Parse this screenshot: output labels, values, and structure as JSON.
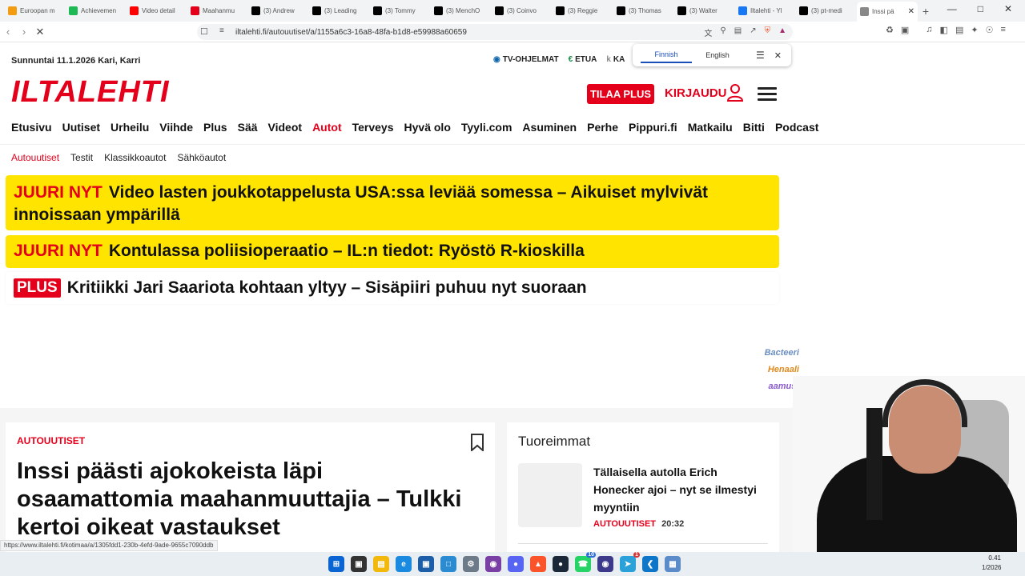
{
  "browser": {
    "tabs": [
      {
        "label": "Euroopan m",
        "icon": "alert-icon",
        "color": "#f39c12"
      },
      {
        "label": "Achievemen",
        "icon": "k-icon",
        "color": "#1db954"
      },
      {
        "label": "Video detail",
        "icon": "youtube-icon",
        "color": "#ff0000"
      },
      {
        "label": "Maahanmu",
        "icon": "il-icon",
        "color": "#e4001b"
      },
      {
        "label": "(3) Andrew",
        "icon": "x-icon",
        "color": "#000000"
      },
      {
        "label": "(3) Leading",
        "icon": "x-icon",
        "color": "#000000"
      },
      {
        "label": "(3) Tommy",
        "icon": "x-icon",
        "color": "#000000"
      },
      {
        "label": "(3) MenchO",
        "icon": "x-icon",
        "color": "#000000"
      },
      {
        "label": "(3) Coinvo",
        "icon": "x-icon",
        "color": "#000000"
      },
      {
        "label": "(3) Reggie",
        "icon": "x-icon",
        "color": "#000000"
      },
      {
        "label": "(3) Thomas",
        "icon": "x-icon",
        "color": "#000000"
      },
      {
        "label": "(3) Walter",
        "icon": "x-icon",
        "color": "#000000"
      },
      {
        "label": "Iltalehti - Yl",
        "icon": "facebook-icon",
        "color": "#1877f2"
      },
      {
        "label": "(3) pt-medi",
        "icon": "x-icon",
        "color": "#000000"
      },
      {
        "label": "Inssi pä",
        "icon": "loading-icon",
        "color": "#888888",
        "active": true
      }
    ],
    "url": "iltalehti.fi/autouutiset/a/1155a6c3-16a8-48fa-b1d8-e59988a60659",
    "status_url": "https://www.iltalehti.fi/kotimaa/a/1305fdd1-230b-4efd-9ade-9655c7090ddb",
    "translate": {
      "source": "Finnish",
      "target": "English"
    }
  },
  "site": {
    "date_line": "Sunnuntai 11.1.2026  Kari, Karri",
    "top_links": [
      "TV-OHJELMAT",
      "ETUA",
      "KA"
    ],
    "logo": "ILTALEHTI",
    "subscribe_label": "TILAA PLUS",
    "login_label": "KIRJAUDU",
    "main_nav": [
      {
        "label": "Etusivu"
      },
      {
        "label": "Uutiset"
      },
      {
        "label": "Urheilu"
      },
      {
        "label": "Viihde"
      },
      {
        "label": "Plus"
      },
      {
        "label": "Sää"
      },
      {
        "label": "Videot"
      },
      {
        "label": "Autot",
        "active": true
      },
      {
        "label": "Terveys"
      },
      {
        "label": "Hyvä olo"
      },
      {
        "label": "Tyyli.com"
      },
      {
        "label": "Asuminen"
      },
      {
        "label": "Perhe"
      },
      {
        "label": "Pippuri.fi"
      },
      {
        "label": "Matkailu"
      },
      {
        "label": "Bitti"
      },
      {
        "label": "Podcast"
      }
    ],
    "sub_nav": [
      {
        "label": "Autouutiset",
        "active": true
      },
      {
        "label": "Testit"
      },
      {
        "label": "Klassikkoautot"
      },
      {
        "label": "Sähköautot"
      }
    ],
    "accent": "#e4001b",
    "breaking_color": "#ffe400"
  },
  "breaking": [
    {
      "kicker": "JUURI NYT",
      "text": "Video lasten joukkotappelusta USA:ssa leviää somessa – Aikuiset mylvivät innoissaan ympärillä"
    },
    {
      "kicker": "JUURI NYT",
      "text": "Kontulassa poliisioperaatio – IL:n tiedot: Ryöstö R-kioskilla"
    }
  ],
  "plus_item": {
    "badge": "PLUS",
    "text": "Kritiikki Jari Saariota kohtaan yltyy – Sisäpiiri puhuu nyt suoraan"
  },
  "sponsors": [
    {
      "name": "Bacteeri",
      "color": "#6b8fc0"
    },
    {
      "name": "Henaali",
      "color": "#e08a1e"
    },
    {
      "name": "aamust",
      "color": "#8a5bd0"
    }
  ],
  "article": {
    "category": "AUTOUUTISET",
    "title": "Inssi päästi ajokokeista läpi osaamattomia maahanmuuttajia – Tulkki kertoi oikeat vastaukset"
  },
  "latest": {
    "heading": "Tuoreimmat",
    "items": [
      {
        "title": "Tällaisella autolla Erich Honecker ajoi – nyt se ilmestyi myyntiin",
        "category": "AUTOUUTISET",
        "time": "20:32"
      }
    ]
  },
  "taskbar": {
    "clock_time": "0.41",
    "clock_date": "1/2026",
    "badges": [
      "10",
      "1"
    ]
  }
}
